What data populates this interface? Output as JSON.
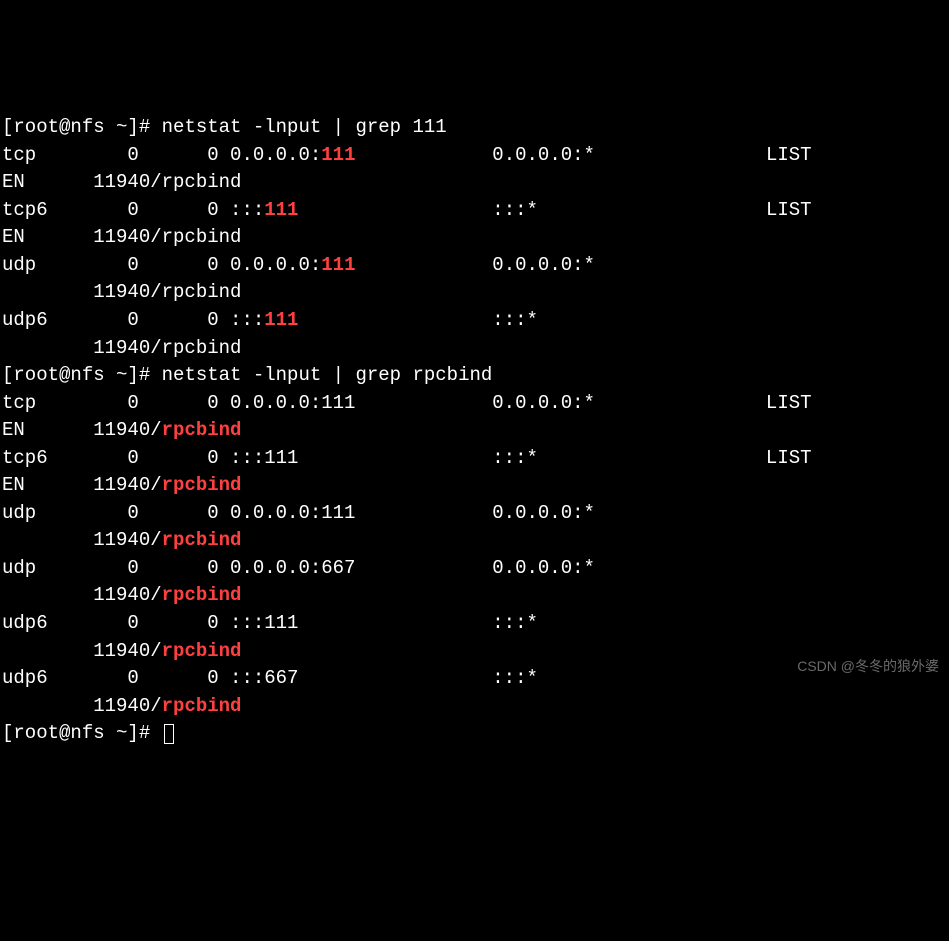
{
  "prompt1": "[root@nfs ~]# ",
  "cmd1": "netstat -lnput | grep 111",
  "block1": [
    {
      "proto": "tcp ",
      "recv": "       0",
      "send": "      0 ",
      "local_pre": "0.0.0.0:",
      "match": "111",
      "local_post": "",
      "foreign": "            0.0.0.0:*",
      "state": "               LIST",
      "wrap_pre": "EN      11940/rpcbind",
      "wrap_match": "",
      "wrap_post": ""
    },
    {
      "proto": "tcp6",
      "recv": "       0",
      "send": "      0 ",
      "local_pre": ":::",
      "match": "111",
      "local_post": "",
      "foreign": "                 :::*",
      "state": "                    LIST",
      "wrap_pre": "EN      11940/rpcbind",
      "wrap_match": "",
      "wrap_post": ""
    },
    {
      "proto": "udp ",
      "recv": "       0",
      "send": "      0 ",
      "local_pre": "0.0.0.0:",
      "match": "111",
      "local_post": "",
      "foreign": "            0.0.0.0:*",
      "state": "",
      "wrap_pre": "        11940/rpcbind",
      "wrap_match": "",
      "wrap_post": ""
    },
    {
      "proto": "udp6",
      "recv": "       0",
      "send": "      0 ",
      "local_pre": ":::",
      "match": "111",
      "local_post": "",
      "foreign": "                 :::*",
      "state": "",
      "wrap_pre": "        11940/rpcbind",
      "wrap_match": "",
      "wrap_post": ""
    }
  ],
  "prompt2": "[root@nfs ~]# ",
  "cmd2": "netstat -lnput | grep rpcbind",
  "block2": [
    {
      "proto": "tcp ",
      "recv": "       0",
      "send": "      0 ",
      "local": "0.0.0.0:111",
      "foreign": "            0.0.0.0:*",
      "state": "               LIST",
      "wrap_pre": "EN      11940/",
      "wrap_match": "rpcbind"
    },
    {
      "proto": "tcp6",
      "recv": "       0",
      "send": "      0 ",
      "local": ":::111",
      "foreign": "                 :::*",
      "state": "                    LIST",
      "wrap_pre": "EN      11940/",
      "wrap_match": "rpcbind"
    },
    {
      "proto": "udp ",
      "recv": "       0",
      "send": "      0 ",
      "local": "0.0.0.0:111",
      "foreign": "            0.0.0.0:*",
      "state": "",
      "wrap_pre": "        11940/",
      "wrap_match": "rpcbind"
    },
    {
      "proto": "udp ",
      "recv": "       0",
      "send": "      0 ",
      "local": "0.0.0.0:667",
      "foreign": "            0.0.0.0:*",
      "state": "",
      "wrap_pre": "        11940/",
      "wrap_match": "rpcbind"
    },
    {
      "proto": "udp6",
      "recv": "       0",
      "send": "      0 ",
      "local": ":::111",
      "foreign": "                 :::*",
      "state": "",
      "wrap_pre": "        11940/",
      "wrap_match": "rpcbind"
    },
    {
      "proto": "udp6",
      "recv": "       0",
      "send": "      0 ",
      "local": ":::667",
      "foreign": "                 :::*",
      "state": "",
      "wrap_pre": "        11940/",
      "wrap_match": "rpcbind"
    }
  ],
  "prompt3": "[root@nfs ~]# ",
  "watermark": "CSDN @冬冬的狼外婆"
}
